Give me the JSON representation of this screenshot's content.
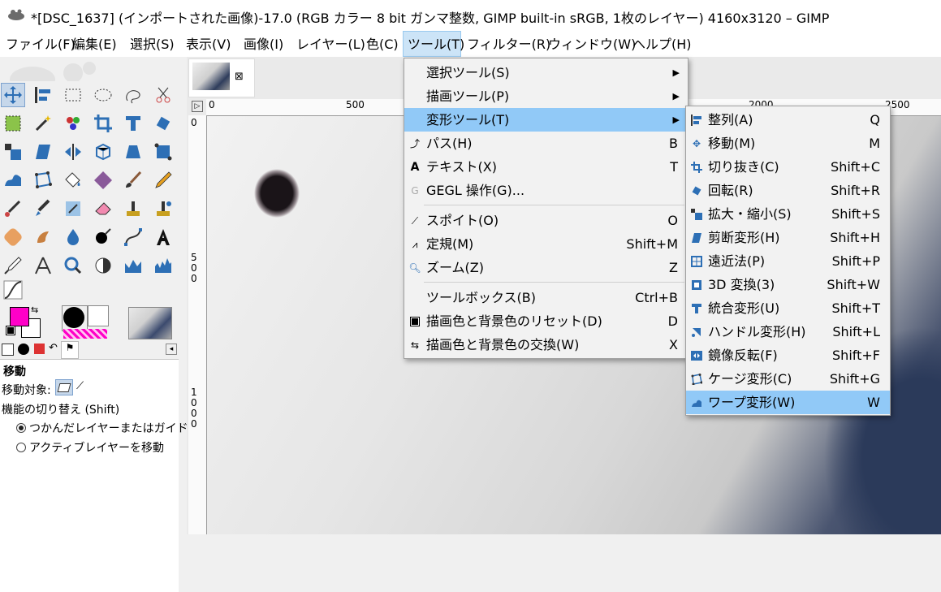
{
  "window": {
    "title": "*[DSC_1637] (インポートされた画像)-17.0 (RGB カラー 8 bit ガンマ整数, GIMP built-in sRGB, 1枚のレイヤー) 4160x3120 – GIMP"
  },
  "menubar": [
    "ファイル(F)",
    "編集(E)",
    "選択(S)",
    "表示(V)",
    "画像(I)",
    "レイヤー(L)",
    "色(C)",
    "ツール(T)",
    "フィルター(R)",
    "ウィンドウ(W)",
    "ヘルプ(H)"
  ],
  "colors": {
    "foreground": "#ff00c8",
    "background": "#ffffff",
    "menu_highlight": "#91c9f7"
  },
  "tool_options": {
    "title": "移動",
    "target_label": "移動対象:",
    "toggle_label": "機能の切り替え (Shift)",
    "radio1": "つかんだレイヤーまたはガイドを移",
    "radio2": "アクティブレイヤーを移動"
  },
  "rulers": {
    "h": [
      "0",
      "500",
      "2000",
      "2500"
    ],
    "v": [
      "0",
      "5",
      "0",
      "0",
      "1",
      "0",
      "0",
      "0"
    ]
  },
  "tools_menu": [
    {
      "label": "選択ツール(S)",
      "shortcut": "",
      "submenu": true,
      "icon": "none"
    },
    {
      "label": "描画ツール(P)",
      "shortcut": "",
      "submenu": true,
      "icon": "none"
    },
    {
      "label": "変形ツール(T)",
      "shortcut": "",
      "submenu": true,
      "icon": "none"
    },
    {
      "label": "パス(H)",
      "shortcut": "B",
      "submenu": false,
      "icon": "path-icon"
    },
    {
      "label": "テキスト(X)",
      "shortcut": "T",
      "submenu": false,
      "icon": "text-icon"
    },
    {
      "label": "GEGL 操作(G)...",
      "shortcut": "",
      "submenu": false,
      "icon": "gegl-icon"
    },
    {
      "label": "スポイト(O)",
      "shortcut": "O",
      "submenu": false,
      "icon": "eyedropper-icon"
    },
    {
      "label": "定規(M)",
      "shortcut": "Shift+M",
      "submenu": false,
      "icon": "measure-icon"
    },
    {
      "label": "ズーム(Z)",
      "shortcut": "Z",
      "submenu": false,
      "icon": "zoom-icon"
    },
    {
      "label": "ツールボックス(B)",
      "shortcut": "Ctrl+B",
      "submenu": false,
      "icon": "none"
    },
    {
      "label": "描画色と背景色のリセット(D)",
      "shortcut": "D",
      "submenu": false,
      "icon": "reset-colors-icon"
    },
    {
      "label": "描画色と背景色の交換(W)",
      "shortcut": "X",
      "submenu": false,
      "icon": "swap-colors-icon"
    }
  ],
  "transform_menu": [
    {
      "label": "整列(A)",
      "shortcut": "Q",
      "icon": "align-icon"
    },
    {
      "label": "移動(M)",
      "shortcut": "M",
      "icon": "move-icon"
    },
    {
      "label": "切り抜き(C)",
      "shortcut": "Shift+C",
      "icon": "crop-icon"
    },
    {
      "label": "回転(R)",
      "shortcut": "Shift+R",
      "icon": "rotate-icon"
    },
    {
      "label": "拡大・縮小(S)",
      "shortcut": "Shift+S",
      "icon": "scale-icon"
    },
    {
      "label": "剪断変形(H)",
      "shortcut": "Shift+H",
      "icon": "shear-icon"
    },
    {
      "label": "遠近法(P)",
      "shortcut": "Shift+P",
      "icon": "perspective-icon"
    },
    {
      "label": "3D 変換(3)",
      "shortcut": "Shift+W",
      "icon": "3d-transform-icon"
    },
    {
      "label": "統合変形(U)",
      "shortcut": "Shift+T",
      "icon": "unified-transform-icon"
    },
    {
      "label": "ハンドル変形(H)",
      "shortcut": "Shift+L",
      "icon": "handle-transform-icon"
    },
    {
      "label": "鏡像反転(F)",
      "shortcut": "Shift+F",
      "icon": "flip-icon"
    },
    {
      "label": "ケージ変形(C)",
      "shortcut": "Shift+G",
      "icon": "cage-icon"
    },
    {
      "label": "ワープ変形(W)",
      "shortcut": "W",
      "icon": "warp-icon"
    }
  ]
}
